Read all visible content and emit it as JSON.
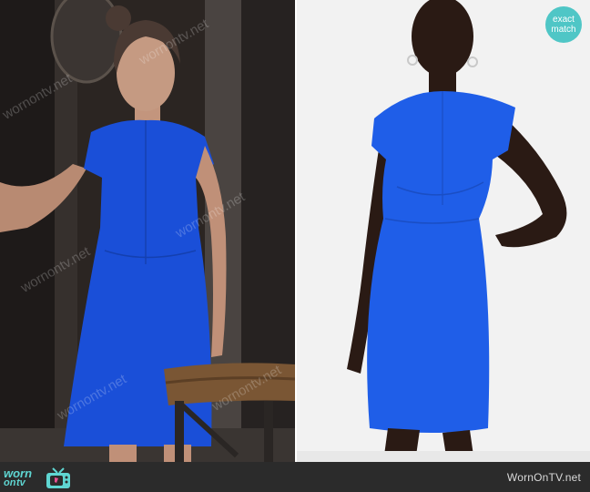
{
  "badge": {
    "line1": "exact",
    "line2": "match",
    "color": "#4fc6c6"
  },
  "footer": {
    "logo_worn": "worn",
    "logo_on": "on",
    "logo_tv": "tv",
    "site_name": "WornOnTV.net",
    "accent": "#5fd6d2",
    "background": "#2b2b2b"
  },
  "watermark": {
    "text": "wornontv.net"
  },
  "photos": {
    "dress_color": "#1a4fd8",
    "product_dress_color": "#1f5ee8"
  }
}
